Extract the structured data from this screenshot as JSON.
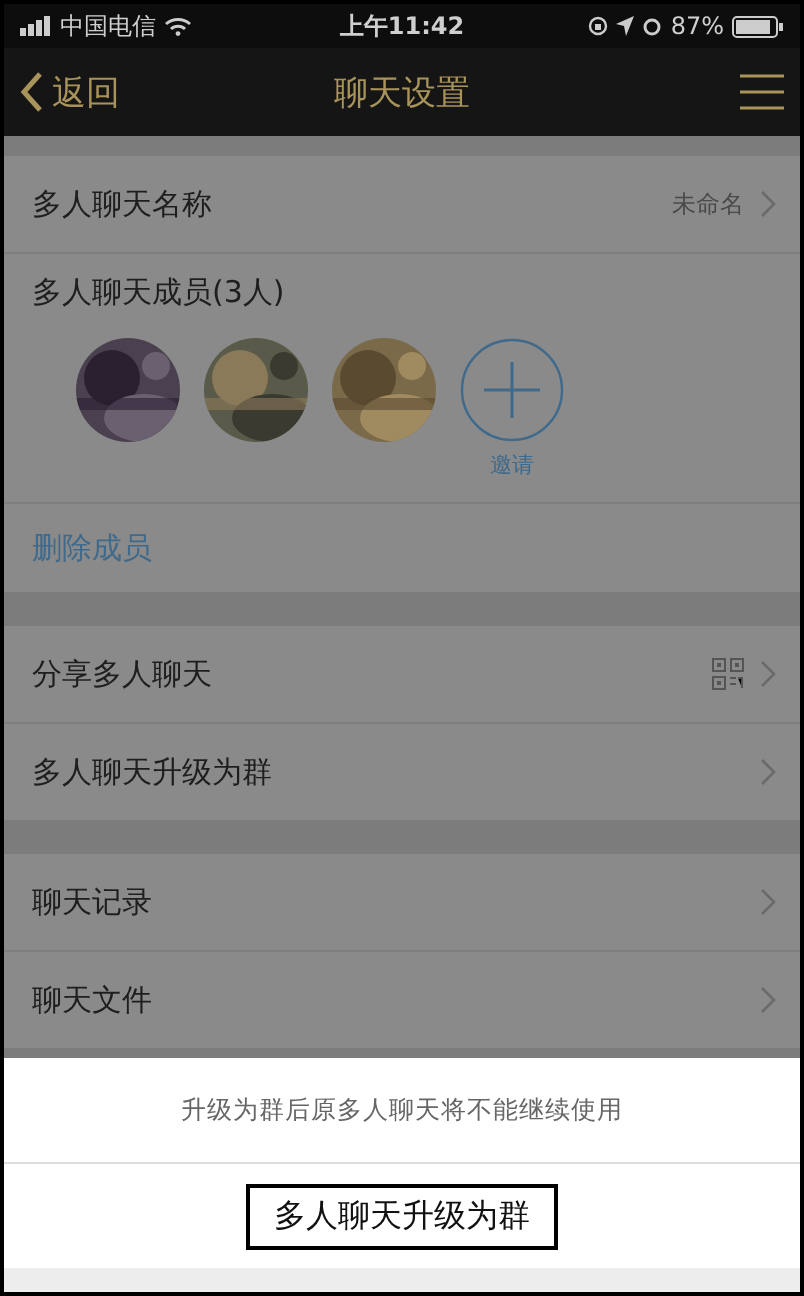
{
  "status_bar": {
    "carrier": "中国电信",
    "time": "上午11:42",
    "battery": "87%"
  },
  "nav": {
    "back": "返回",
    "title": "聊天设置"
  },
  "name_row": {
    "label": "多人聊天名称",
    "value": "未命名"
  },
  "members": {
    "title": "多人聊天成员(3人)",
    "invite": "邀请",
    "remove": "删除成员"
  },
  "groups": [
    [
      {
        "label": "分享多人聊天",
        "kind": "share"
      },
      {
        "label": "多人聊天升级为群"
      }
    ],
    [
      {
        "label": "聊天记录"
      },
      {
        "label": "聊天文件"
      }
    ]
  ],
  "sheet": {
    "message": "升级为群后原多人聊天将不能继续使用",
    "action": {
      "label": "多人聊天升级为群",
      "highlighted": true
    }
  }
}
